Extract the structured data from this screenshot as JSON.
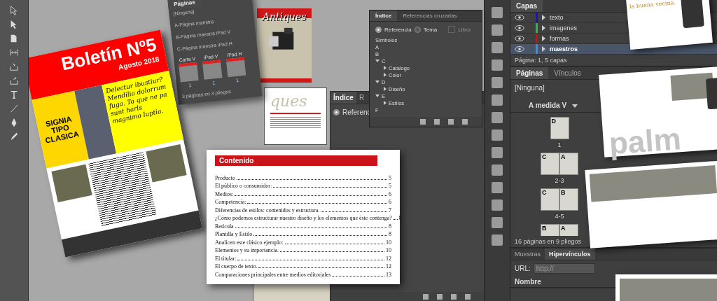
{
  "newsletter": {
    "title": "Boletín Nº5",
    "date": "Agosto 2018",
    "badge_lines": [
      "SIGNIA",
      "TIPO",
      "CLASICA"
    ],
    "headline": "Delectur ibustiur? Mendilia dolorrum fuga. To que ne pa sunt harls magnimo luptia."
  },
  "floating_pages_panel": {
    "tab": "Páginas",
    "masters": [
      "[Ninguna]",
      "A-Página maestra",
      "B-Página maestra iPad V",
      "C-Página maestra iPad H"
    ],
    "sections": [
      {
        "label": "Carta V",
        "page": "1"
      },
      {
        "label": "iPad V",
        "page": "1"
      },
      {
        "label": "iPad H",
        "page": "1"
      }
    ],
    "footer": "3 páginas en 3 pliegos"
  },
  "antiques": {
    "logo": "Antiques",
    "partial": "ques"
  },
  "contents": {
    "title": "Contenido",
    "entries": [
      {
        "text": "Producto",
        "page": "5"
      },
      {
        "text": "El público o consumidor:",
        "page": "5"
      },
      {
        "text": "Medios:",
        "page": "6"
      },
      {
        "text": "Competencia:",
        "page": "6"
      },
      {
        "text": "Diferencias de estilos: contenidos y estructura.",
        "page": "7"
      },
      {
        "text": "¿Cómo podemos estructurar nuestro diseño y los elementos que éste contenga?",
        "page": "8"
      },
      {
        "text": "Retícula",
        "page": "8"
      },
      {
        "text": "Plantilla y Estilo",
        "page": "8"
      },
      {
        "text": "Analicen este clásico ejemplo:",
        "page": "10"
      },
      {
        "text": "Elementos y su importancia.",
        "page": "10"
      },
      {
        "text": "El titular:",
        "page": "12"
      },
      {
        "text": "El cuerpo de texto.",
        "page": "12"
      },
      {
        "text": "Comparaciones principales entre medios editoriales",
        "page": "13"
      }
    ]
  },
  "index_back": {
    "tabs": [
      {
        "label": "Índice",
        "selected": true
      },
      {
        "label": "R",
        "selected": false
      }
    ],
    "radio": {
      "label": "Referenc",
      "selected": true
    }
  },
  "index_panel": {
    "tabs": [
      {
        "label": "Índice",
        "selected": true
      },
      {
        "label": "Referencias cruzadas",
        "selected": false
      }
    ],
    "radios": [
      {
        "label": "Referencia",
        "selected": true
      },
      {
        "label": "Tema",
        "selected": false
      }
    ],
    "checkbox": {
      "label": "Libro",
      "disabled": true
    },
    "tree": [
      {
        "label": "Símbolos",
        "expanded": false
      },
      {
        "label": "A",
        "expanded": false
      },
      {
        "label": "B",
        "expanded": false
      },
      {
        "label": "C",
        "expanded": true,
        "children": [
          {
            "label": "Catálogo"
          },
          {
            "label": "Color"
          }
        ]
      },
      {
        "label": "D",
        "expanded": true,
        "children": [
          {
            "label": "Diseño"
          }
        ]
      },
      {
        "label": "E",
        "expanded": true,
        "children": [
          {
            "label": "Estilos"
          }
        ]
      },
      {
        "label": "F",
        "expanded": false
      }
    ]
  },
  "layers": {
    "tab": "Capas",
    "rows": [
      {
        "name": "texto",
        "color": "#1010e0",
        "selected": false
      },
      {
        "name": "imagenes",
        "color": "#20c040",
        "selected": false
      },
      {
        "name": "formas",
        "color": "#d01010",
        "selected": false
      },
      {
        "name": "maestros",
        "color": "#3a8ee0",
        "selected": true
      }
    ],
    "status": "Página: 1, 5 capas"
  },
  "pages": {
    "tabs": [
      {
        "label": "Páginas",
        "selected": true
      },
      {
        "label": "Vínculos",
        "selected": false
      }
    ],
    "none": "[Ninguna]",
    "size": "A medida V",
    "spreads": [
      {
        "label": "1",
        "masters": [
          "D"
        ]
      },
      {
        "label": "2-3",
        "masters": [
          "C",
          "A"
        ]
      },
      {
        "label": "4-5",
        "masters": [
          "C",
          "B"
        ]
      },
      {
        "masters": [
          "B",
          "A"
        ]
      }
    ],
    "status": "16 páginas en 9 pliegos"
  },
  "links": {
    "tabs": [
      {
        "label": "Muestras",
        "selected": false
      },
      {
        "label": "Hipervínculos",
        "selected": true
      }
    ],
    "url_label": "URL:",
    "url": "http://",
    "name_label": "Nombre"
  },
  "brochure": {
    "slogan": "la buena vecina.",
    "watermark": "palm"
  }
}
